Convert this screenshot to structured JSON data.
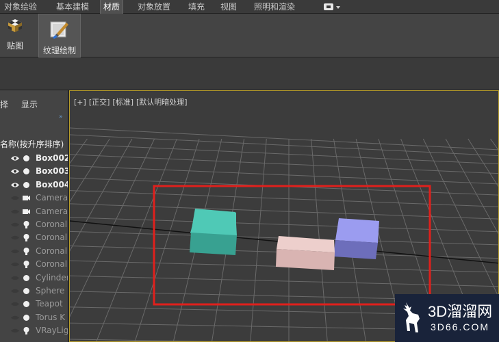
{
  "tabs": [
    {
      "label": "对象绘验"
    },
    {
      "label": "基本建模"
    },
    {
      "label": "材质"
    },
    {
      "label": "对象放置"
    },
    {
      "label": "填充"
    },
    {
      "label": "视图"
    },
    {
      "label": "照明和渲染"
    }
  ],
  "ribbon": {
    "map_label": "贴图",
    "texture_paint_label": "纹理绘制"
  },
  "explorer": {
    "header_select": "择",
    "header_display": "显示",
    "column_name": "名称(按升序排序)",
    "rows": [
      {
        "name": "Box002"
      },
      {
        "name": "Box003"
      },
      {
        "name": "Box004"
      },
      {
        "name": "Camera"
      },
      {
        "name": "Camera"
      },
      {
        "name": "Coronal"
      },
      {
        "name": "Coronal"
      },
      {
        "name": "Coronal"
      },
      {
        "name": "Coronal"
      },
      {
        "name": "Cylinder"
      },
      {
        "name": "Sphere"
      },
      {
        "name": "Teapot"
      },
      {
        "name": "Torus K"
      },
      {
        "name": "VRayLig"
      }
    ]
  },
  "viewport": {
    "label_plus": "[+]",
    "label_view": "[正交]",
    "label_shading": "[标准]",
    "label_lighting": "[默认明暗处理]",
    "box_colors": {
      "teal": "#4fc9b6",
      "pink": "#e9c6c4",
      "blue": "#9b9cf0"
    },
    "selection_color": "#e0201c"
  },
  "watermark": {
    "main": "3D溜溜网",
    "sub": "3D66.COM"
  }
}
